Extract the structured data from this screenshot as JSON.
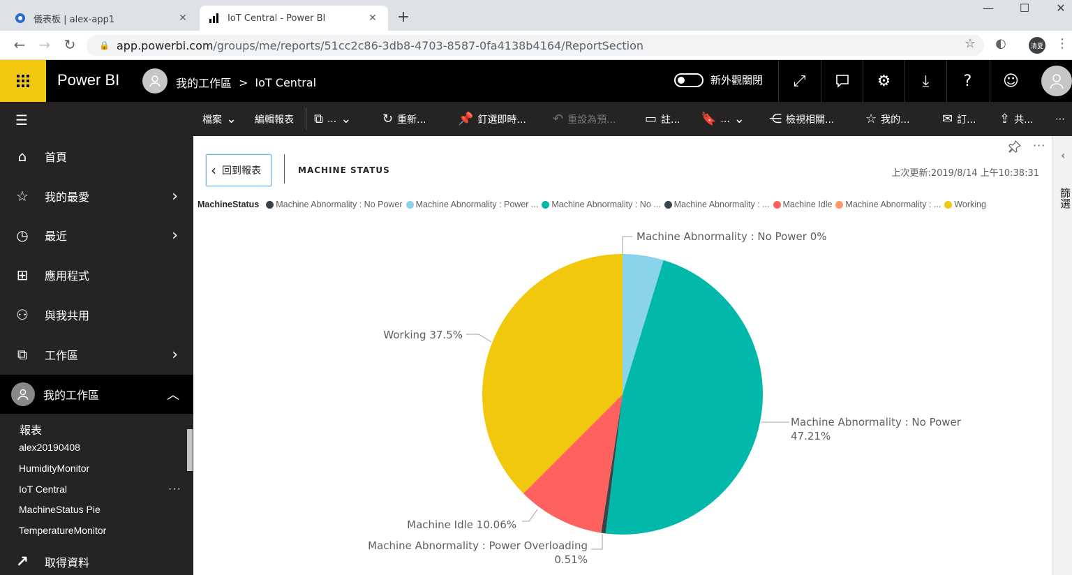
{
  "browser": {
    "tabs": [
      {
        "title": "儀表板 | alex-app1",
        "active": false,
        "icon": "powerbi-app-icon"
      },
      {
        "title": "IoT Central - Power BI",
        "active": true,
        "icon": "powerbi-bars-icon"
      }
    ],
    "tab_close": "✕",
    "new_tab": "+",
    "url_host": "app.powerbi.com",
    "url_path": "/groups/me/reports/51cc2c86-3db8-4703-8587-0fa4138b4164/ReportSection",
    "profile_badge": "清夏"
  },
  "header": {
    "brand": "Power BI",
    "breadcrumb_workspace": "我的工作區",
    "breadcrumb_sep": ">",
    "breadcrumb_report": "IoT Central",
    "toggle_label": "新外觀關閉"
  },
  "actionbar": {
    "file": "檔案",
    "edit": "編輯報表",
    "more1": "...",
    "refresh": "重新...",
    "pin": "釘選即時...",
    "reset": "重設為預...",
    "comment": "註...",
    "more2": "...",
    "related": "檢視相關...",
    "favorite": "我的...",
    "subscribe": "訂...",
    "share": "共...",
    "overflow": "⋯"
  },
  "sidebar": {
    "items": [
      {
        "label": "首頁",
        "icon": "home-icon",
        "has_chevron": false
      },
      {
        "label": "我的最愛",
        "icon": "star-icon",
        "has_chevron": true
      },
      {
        "label": "最近",
        "icon": "clock-icon",
        "has_chevron": true
      },
      {
        "label": "應用程式",
        "icon": "apps-icon",
        "has_chevron": false
      },
      {
        "label": "與我共用",
        "icon": "shared-icon",
        "has_chevron": false
      },
      {
        "label": "工作區",
        "icon": "workspaces-icon",
        "has_chevron": true
      }
    ],
    "my_workspace": "我的工作區",
    "reports_heading": "報表",
    "reports": [
      "alex20190408",
      "HumidityMonitor",
      "IoT Central",
      "MachineStatus Pie",
      "TemperatureMonitor"
    ],
    "report_more": "···",
    "get_data": "取得資料"
  },
  "visual": {
    "back_label": "回到報表",
    "title": "MACHINE STATUS",
    "last_refresh": "上次更新:2019/8/14 上午10:38:31",
    "right_pane_label": "篩選"
  },
  "legend": {
    "title": "MachineStatus",
    "items": [
      {
        "label": "Machine Abnormality : No Power",
        "color": "#3b4148"
      },
      {
        "label": "Machine Abnormality : Power ...",
        "color": "#8ad4eb"
      },
      {
        "label": "Machine Abnormality : No ...",
        "color": "#01b8aa"
      },
      {
        "label": "Machine Abnormality : ...",
        "color": "#374649"
      },
      {
        "label": "Machine Idle",
        "color": "#fd625e"
      },
      {
        "label": "Machine Abnormality : ...",
        "color": "#fe9666"
      },
      {
        "label": "Working",
        "color": "#f2c80f"
      }
    ]
  },
  "chart_data": {
    "type": "pie",
    "slices": [
      {
        "label": "Machine Abnormality : No Power",
        "value": 0,
        "display": "Machine Abnormality : No Power 0%",
        "color": "#3b4148"
      },
      {
        "label": "Machine Abnormality : Power ...",
        "value": 4.72,
        "display": "",
        "color": "#8ad4eb"
      },
      {
        "label": "Machine Abnormality : No Power",
        "value": 47.21,
        "display": "Machine Abnormality : No Power 47.21%",
        "color": "#01b8aa"
      },
      {
        "label": "Machine Abnormality : Power Overloading",
        "value": 0.51,
        "display": "Machine Abnormality : Power Overloading 0.51%",
        "color": "#374649"
      },
      {
        "label": "Machine Idle",
        "value": 10.06,
        "display": "Machine Idle 10.06%",
        "color": "#fd625e"
      },
      {
        "label": "Working",
        "value": 37.5,
        "display": "Working 37.5%",
        "color": "#f2c80f"
      }
    ],
    "labels": {
      "top": "Machine Abnormality : No Power 0%",
      "right_line1": "Machine Abnormality : No Power",
      "right_line2": "47.21%",
      "working": "Working 37.5%",
      "idle": "Machine Idle 10.06%",
      "overload_line1": "Machine Abnormality : Power Overloading",
      "overload_line2": "0.51%"
    }
  }
}
